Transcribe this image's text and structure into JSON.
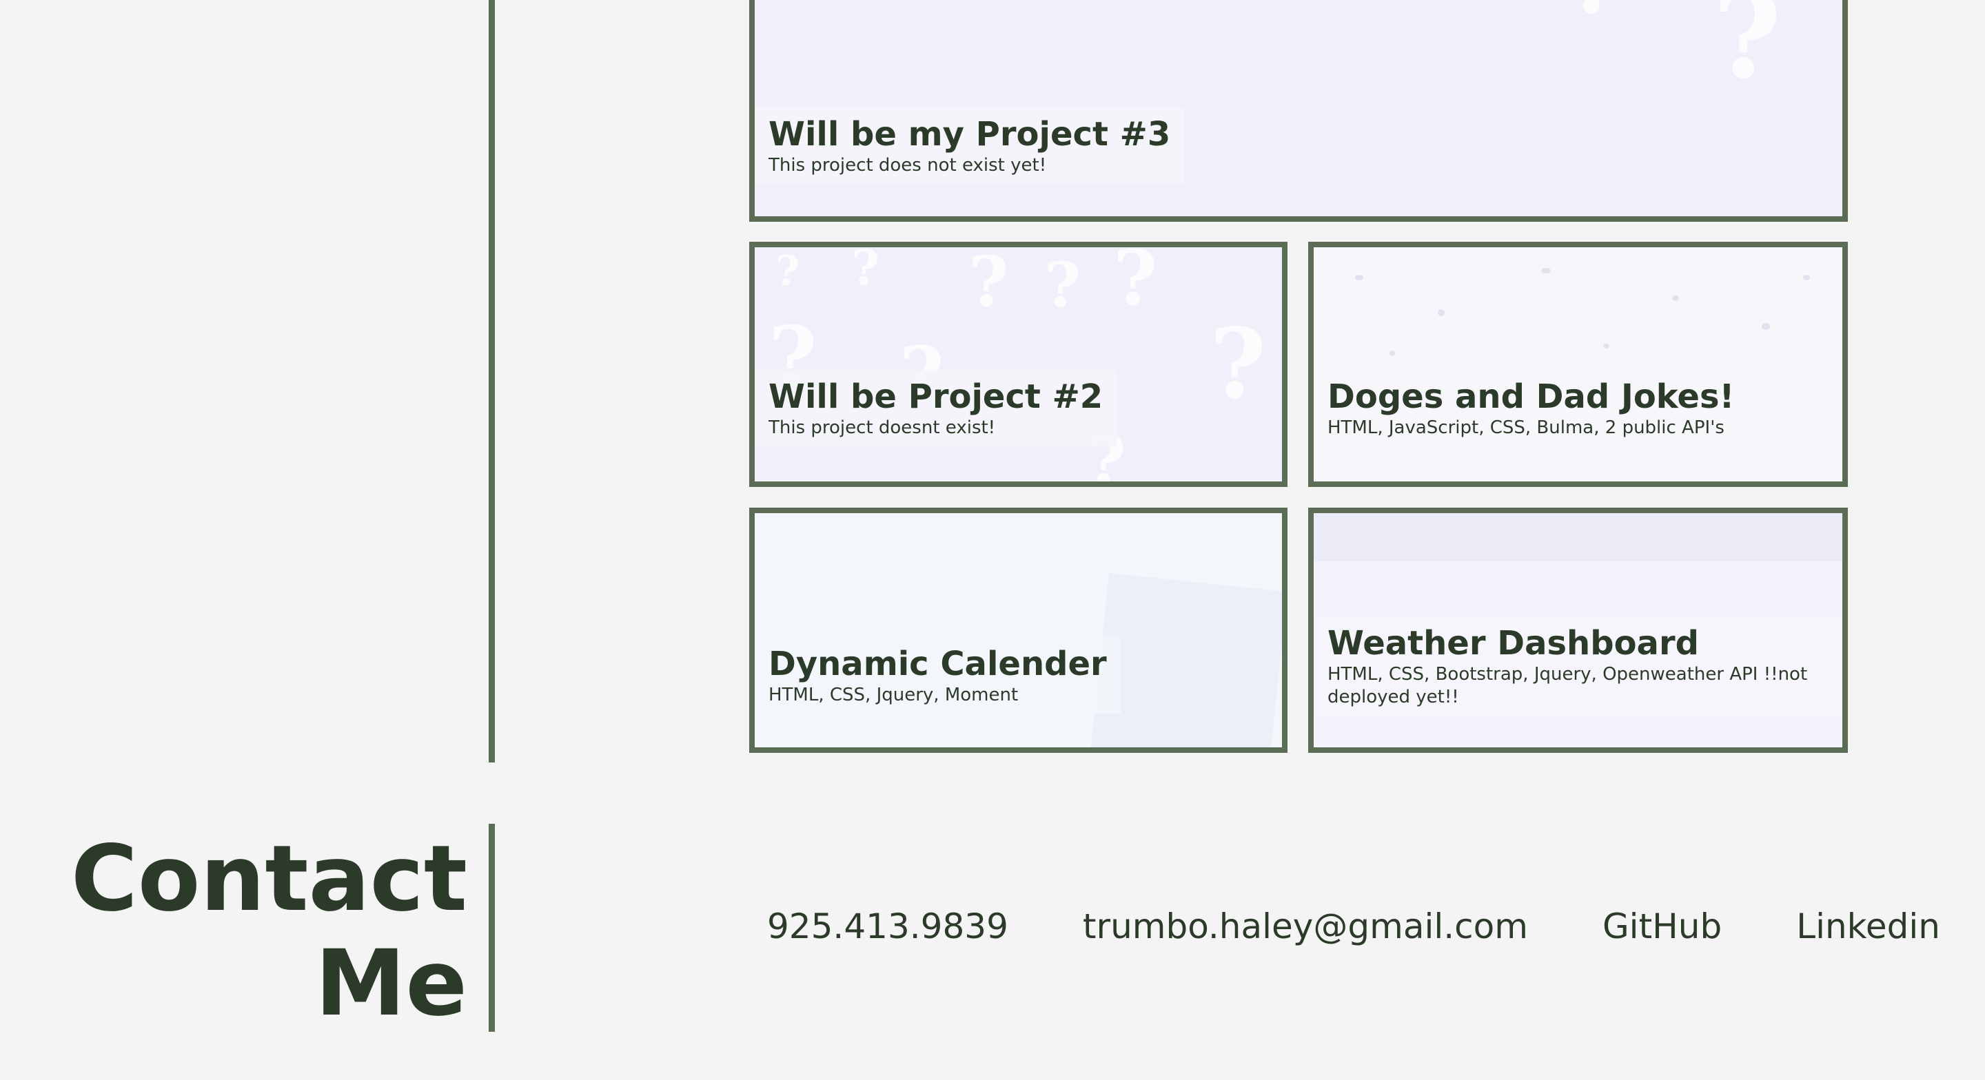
{
  "projects": [
    {
      "title": "Will be my Project #3",
      "description": "This project does not exist yet!"
    },
    {
      "title": "Will be Project #2",
      "description": "This project doesnt exist!"
    },
    {
      "title": "Doges and Dad Jokes!",
      "description": "HTML, JavaScript, CSS, Bulma, 2 public API's"
    },
    {
      "title": "Dynamic Calender",
      "description": "HTML, CSS, Jquery, Moment"
    },
    {
      "title": "Weather Dashboard",
      "description": "HTML, CSS, Bootstrap, Jquery, Openweather API !!not deployed yet!!"
    }
  ],
  "contact": {
    "heading_line1": "Contact",
    "heading_line2": "Me",
    "phone": "925.413.9839",
    "email": "trumbo.haley@gmail.com",
    "github": "GitHub",
    "linkedin": "Linkedin"
  },
  "colors": {
    "background": "#f4f4f4",
    "accent_border": "#5b6e55",
    "text": "#2b3a29"
  },
  "icons": {
    "card_background_pattern": "question-mark-pattern"
  }
}
